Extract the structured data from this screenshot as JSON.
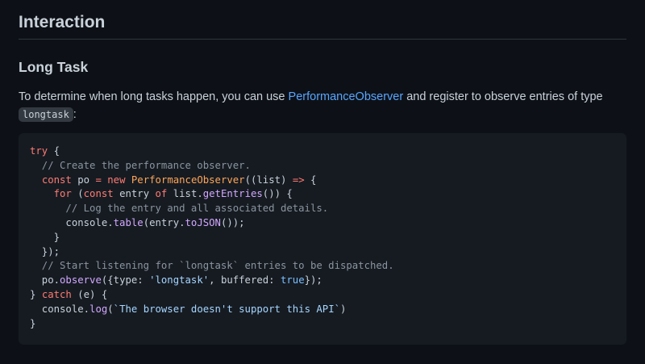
{
  "heading": "Interaction",
  "subheading": "Long Task",
  "paragraph": {
    "text_before": "To determine when long tasks happen, you can use ",
    "link": "PerformanceObserver",
    "text_after": " and register to observe entries of type ",
    "code": "longtask",
    "text_end": ":"
  },
  "code_lines": [
    [
      {
        "t": "try",
        "c": "kw"
      },
      {
        "t": " {",
        "c": ""
      }
    ],
    [
      {
        "t": "  // Create the performance observer.",
        "c": "cm"
      }
    ],
    [
      {
        "t": "  ",
        "c": ""
      },
      {
        "t": "const",
        "c": "kw"
      },
      {
        "t": " po ",
        "c": ""
      },
      {
        "t": "=",
        "c": "op"
      },
      {
        "t": " ",
        "c": ""
      },
      {
        "t": "new",
        "c": "kw"
      },
      {
        "t": " ",
        "c": ""
      },
      {
        "t": "PerformanceObserver",
        "c": "cls"
      },
      {
        "t": "((list) ",
        "c": ""
      },
      {
        "t": "=>",
        "c": "kw"
      },
      {
        "t": " {",
        "c": ""
      }
    ],
    [
      {
        "t": "    ",
        "c": ""
      },
      {
        "t": "for",
        "c": "kw"
      },
      {
        "t": " (",
        "c": ""
      },
      {
        "t": "const",
        "c": "kw"
      },
      {
        "t": " entry ",
        "c": ""
      },
      {
        "t": "of",
        "c": "kw"
      },
      {
        "t": " list.",
        "c": ""
      },
      {
        "t": "getEntries",
        "c": "fn"
      },
      {
        "t": "()) {",
        "c": ""
      }
    ],
    [
      {
        "t": "      // Log the entry and all associated details.",
        "c": "cm"
      }
    ],
    [
      {
        "t": "      console.",
        "c": ""
      },
      {
        "t": "table",
        "c": "fn"
      },
      {
        "t": "(entry.",
        "c": ""
      },
      {
        "t": "toJSON",
        "c": "fn"
      },
      {
        "t": "());",
        "c": ""
      }
    ],
    [
      {
        "t": "    }",
        "c": ""
      }
    ],
    [
      {
        "t": "  });",
        "c": ""
      }
    ],
    [
      {
        "t": "  // Start listening for `longtask` entries to be dispatched.",
        "c": "cm"
      }
    ],
    [
      {
        "t": "  po.",
        "c": ""
      },
      {
        "t": "observe",
        "c": "fn"
      },
      {
        "t": "({type: ",
        "c": ""
      },
      {
        "t": "'longtask'",
        "c": "st"
      },
      {
        "t": ", buffered: ",
        "c": ""
      },
      {
        "t": "true",
        "c": "pr"
      },
      {
        "t": "});",
        "c": ""
      }
    ],
    [
      {
        "t": "} ",
        "c": ""
      },
      {
        "t": "catch",
        "c": "kw"
      },
      {
        "t": " (e) {",
        "c": ""
      }
    ],
    [
      {
        "t": "  console.",
        "c": ""
      },
      {
        "t": "log",
        "c": "fn"
      },
      {
        "t": "(",
        "c": ""
      },
      {
        "t": "`The browser doesn't support this API`",
        "c": "st"
      },
      {
        "t": ")",
        "c": ""
      }
    ],
    [
      {
        "t": "}",
        "c": ""
      }
    ]
  ]
}
